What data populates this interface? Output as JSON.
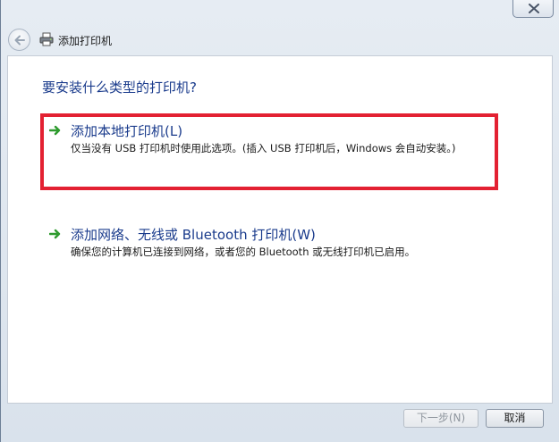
{
  "window": {
    "title": "添加打印机"
  },
  "content": {
    "question": "要安装什么类型的打印机?",
    "options": [
      {
        "label": "添加本地打印机(L)",
        "description": "仅当没有 USB 打印机时使用此选项。(插入 USB 打印机后，Windows 会自动安装。)",
        "icon": "green-arrow-icon"
      },
      {
        "label": "添加网络、无线或 Bluetooth 打印机(W)",
        "description": "确保您的计算机已连接到网络，或者您的 Bluetooth 或无线打印机已启用。",
        "icon": "green-arrow-icon"
      }
    ]
  },
  "footer": {
    "next_label": "下一步(N)",
    "cancel_label": "取消"
  },
  "colors": {
    "heading": "#1a3b8c",
    "highlight_border": "#e32132",
    "arrow": "#2e9b2e"
  }
}
